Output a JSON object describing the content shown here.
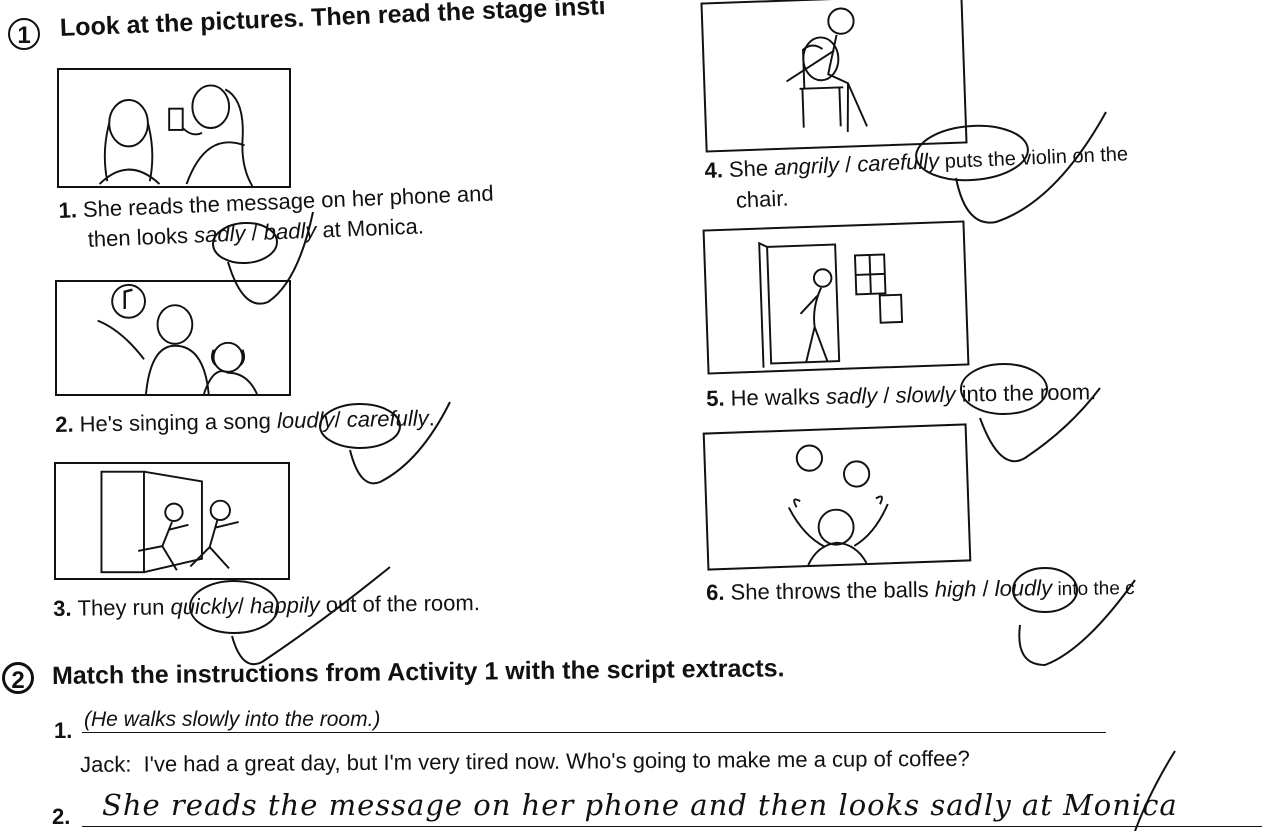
{
  "activity1": {
    "number": "1",
    "heading": "Look at the pictures. Then read the stage insti",
    "items": [
      {
        "num": "1.",
        "before": "She reads the message on her phone and then looks ",
        "opt1": "sadly",
        "sep": " / ",
        "opt2": "badly",
        "after": " at Monica.",
        "line1": "She reads the message on her phone and",
        "line2_before": "then looks ",
        "circled": "sadly"
      },
      {
        "num": "2.",
        "before": "He's singing a song ",
        "opt1": "loudly",
        "sep": "/ ",
        "opt2": "carefully",
        "after": ".",
        "circled": "loudly"
      },
      {
        "num": "3.",
        "before": "They run ",
        "opt1": "quickly",
        "sep": "/ ",
        "opt2": "happily",
        "after": " out of the room.",
        "circled": "quickly"
      },
      {
        "num": "4.",
        "before": "She ",
        "opt1": "angrily",
        "sep": " / ",
        "opt2": "carefully",
        "after": " puts the violin on the",
        "line2": "chair.",
        "circled": "carefully"
      },
      {
        "num": "5.",
        "before": "He walks ",
        "opt1": "sadly",
        "sep": " / ",
        "opt2": "slowly",
        "after": " into the room.",
        "circled": "slowly"
      },
      {
        "num": "6.",
        "before": "She throws the balls ",
        "opt1": "high",
        "sep": " / ",
        "opt2": "loudly",
        "after": " into the c",
        "circled": "high"
      }
    ]
  },
  "activity2": {
    "number": "2",
    "heading": "Match the instructions from Activity 1 with the script extracts.",
    "answers": [
      {
        "num": "1.",
        "text": "(He walks slowly into the room.)"
      },
      {
        "num": "2.",
        "text": "She reads the message on her phone and then looks sadly at Monica"
      }
    ],
    "script": {
      "speaker": "Jack:",
      "line": "I've had a great day, but I'm very tired now. Who's going to make me a cup of coffee?"
    }
  },
  "colors": {
    "ink": "#111111",
    "paper": "#ffffff"
  }
}
